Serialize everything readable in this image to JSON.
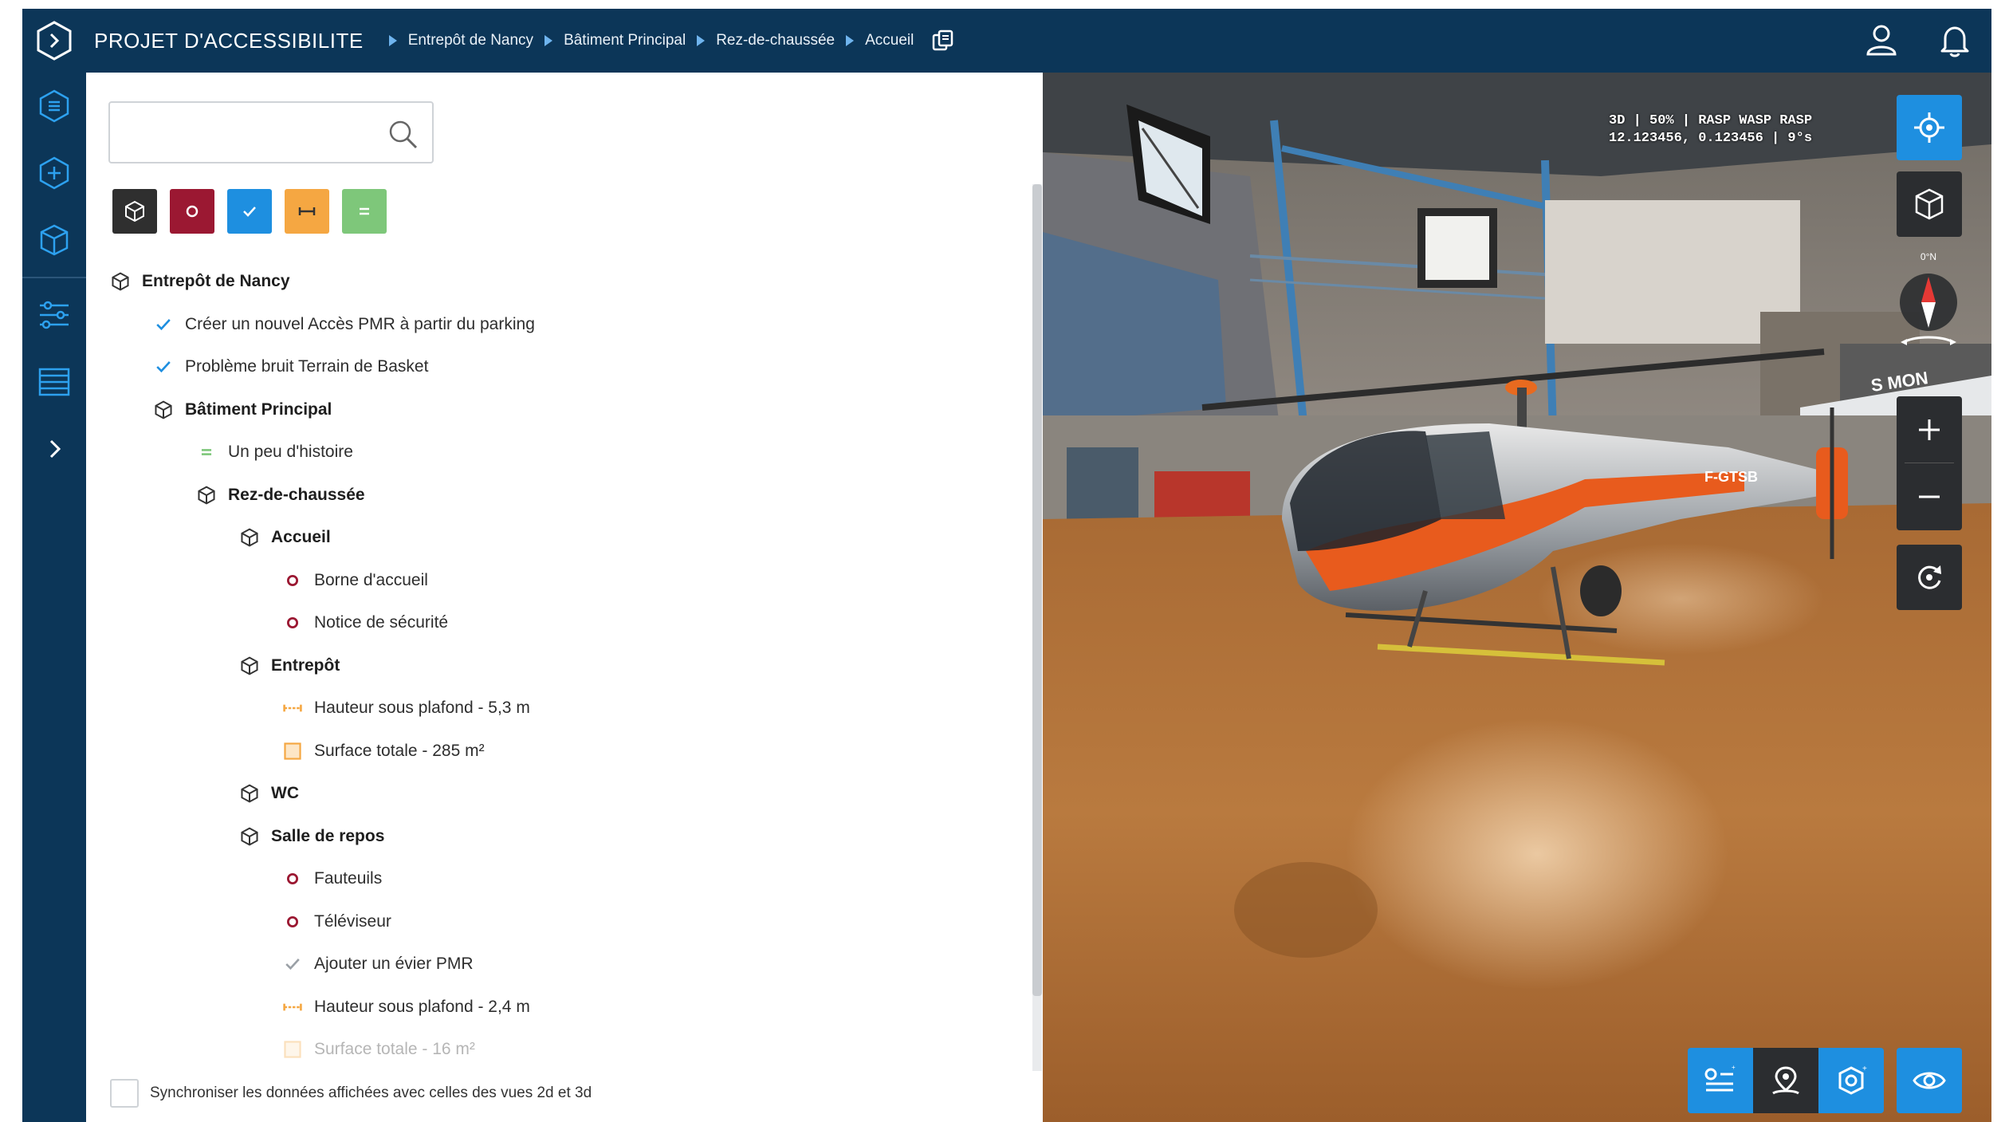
{
  "header": {
    "app_title": "PROJET D'ACCESSIBILITE",
    "breadcrumb": [
      "Entrepôt de Nancy",
      "Bâtiment Principal",
      "Rez-de-chaussée",
      "Accueil"
    ]
  },
  "search": {
    "placeholder": "",
    "value": ""
  },
  "filters": [
    {
      "name": "building",
      "color": "#2f2f2f"
    },
    {
      "name": "point-of-interest",
      "color": "#9b1832"
    },
    {
      "name": "task",
      "color": "#1e8fe0"
    },
    {
      "name": "measure",
      "color": "#f5a742"
    },
    {
      "name": "note",
      "color": "#7ec77a"
    }
  ],
  "tree": [
    {
      "label": "Entrepôt de Nancy",
      "type": "building",
      "level": 0,
      "bold": true
    },
    {
      "label": "Créer un nouvel Accès PMR à partir du parking",
      "type": "task",
      "level": 1
    },
    {
      "label": "Problème bruit Terrain de Basket",
      "type": "task",
      "level": 1
    },
    {
      "label": "Bâtiment Principal",
      "type": "building",
      "level": 1,
      "bold": true
    },
    {
      "label": "Un peu d'histoire",
      "type": "note",
      "level": 2
    },
    {
      "label": "Rez-de-chaussée",
      "type": "building",
      "level": 2,
      "bold": true
    },
    {
      "label": "Accueil",
      "type": "building",
      "level": 3,
      "bold": true
    },
    {
      "label": "Borne d'accueil",
      "type": "poi",
      "level": 4
    },
    {
      "label": "Notice de sécurité",
      "type": "poi",
      "level": 4
    },
    {
      "label": "Entrepôt",
      "type": "building",
      "level": 3,
      "bold": true
    },
    {
      "label": "Hauteur sous plafond - 5,3 m",
      "type": "measure",
      "level": 4
    },
    {
      "label": "Surface totale - 285 m²",
      "type": "area",
      "level": 4
    },
    {
      "label": "WC",
      "type": "building",
      "level": 3,
      "bold": true
    },
    {
      "label": "Salle de repos",
      "type": "building",
      "level": 3,
      "bold": true
    },
    {
      "label": "Fauteuils",
      "type": "poi",
      "level": 4
    },
    {
      "label": "Téléviseur",
      "type": "poi",
      "level": 4
    },
    {
      "label": "Ajouter un évier PMR",
      "type": "task-done",
      "level": 4
    },
    {
      "label": "Hauteur sous plafond - 2,4 m",
      "type": "measure",
      "level": 4
    },
    {
      "label": "Surface totale - 16 m²",
      "type": "area",
      "level": 4,
      "faded": true
    }
  ],
  "sync_label": "Synchroniser les données affichées avec celles des vues 2d et 3d",
  "viewer": {
    "hud_line1": "3D | 50% | RASP WASP RASP",
    "hud_line2": "12.123456, 0.123456 | 9°s",
    "compass_label": "0°N",
    "helicopter_tail_text": "F-GTSB"
  },
  "colors": {
    "header_bg": "#0c3658",
    "accent_blue": "#1e8fe0",
    "poi_red": "#9b1832",
    "measure_orange": "#f5a742",
    "note_green": "#7ec77a"
  }
}
